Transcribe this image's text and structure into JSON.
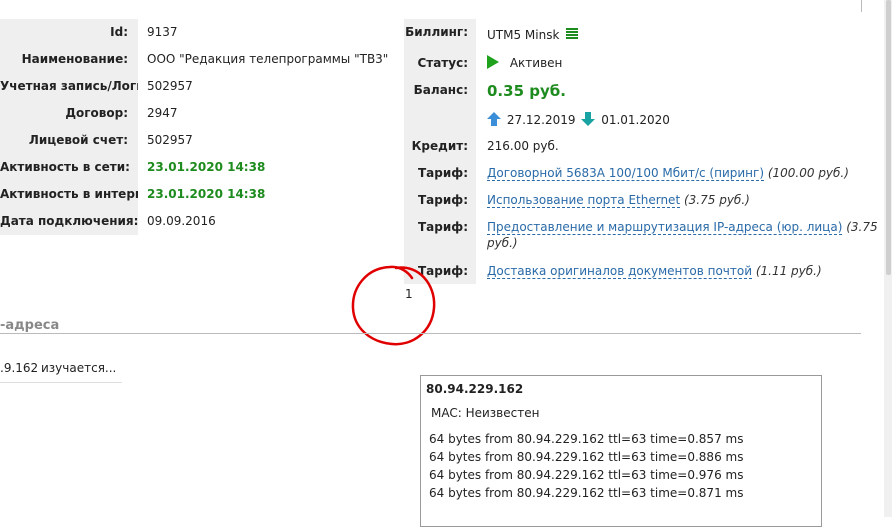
{
  "customer": {
    "labels": [
      "Id:",
      "Наименование:",
      "Учетная запись/Логин:",
      "Договор:",
      "Лицевой счет:",
      "Активность в сети:",
      "Активность в интернете:",
      "Дата подключения:"
    ],
    "values": [
      "9137",
      "ООО \"Редакция телепрограммы \"ТВ3\"",
      "502957",
      "2947",
      "502957",
      "23.01.2020 14:38",
      "23.01.2020 14:38",
      "09.09.2016"
    ]
  },
  "billing": {
    "labels": {
      "billing": "Биллинг:",
      "status": "Статус:",
      "balance": "Баланс:",
      "credit": "Кредит:",
      "tariff": "Тариф:"
    },
    "system": "UTM5 Minsk",
    "status": "Активен",
    "balance": "0.35 руб.",
    "date_up": "27.12.2019",
    "date_down": "01.01.2020",
    "credit": "216.00 руб.",
    "tariffs": [
      {
        "name": "Договорной 5683A 100/100 Мбит/с (пиринг)",
        "price": "(100.00 руб.)"
      },
      {
        "name": "Использование порта Ethernet",
        "price": "(3.75 руб.)"
      },
      {
        "name": "Предоставление и маршрутизация IP-адреса (юр. лица)",
        "price_a": "(3.75",
        "price_b": "руб.)"
      },
      {
        "name": "Доставка оригиналов документов почтой",
        "price": "(1.11 руб.)"
      }
    ],
    "colors": {
      "status_icon": "#1fa31f",
      "arrow_up": "#3a8fd8",
      "arrow_down": "#1aa3a3",
      "balance": "#1e8b1e"
    }
  },
  "annotation": {
    "text": "1",
    "color": "#e00000"
  },
  "section": {
    "title": "-адреса"
  },
  "ip": {
    "value": ".9.162",
    "status": "изучается..."
  },
  "ping": {
    "ip": "80.94.229.162",
    "mac": "MAC: Неизвестен",
    "lines": [
      "64 bytes from 80.94.229.162 ttl=63 time=0.857 ms",
      "64 bytes from 80.94.229.162 ttl=63 time=0.886 ms",
      "64 bytes from 80.94.229.162 ttl=63 time=0.976 ms",
      "64 bytes from 80.94.229.162 ttl=63 time=0.871 ms"
    ]
  }
}
